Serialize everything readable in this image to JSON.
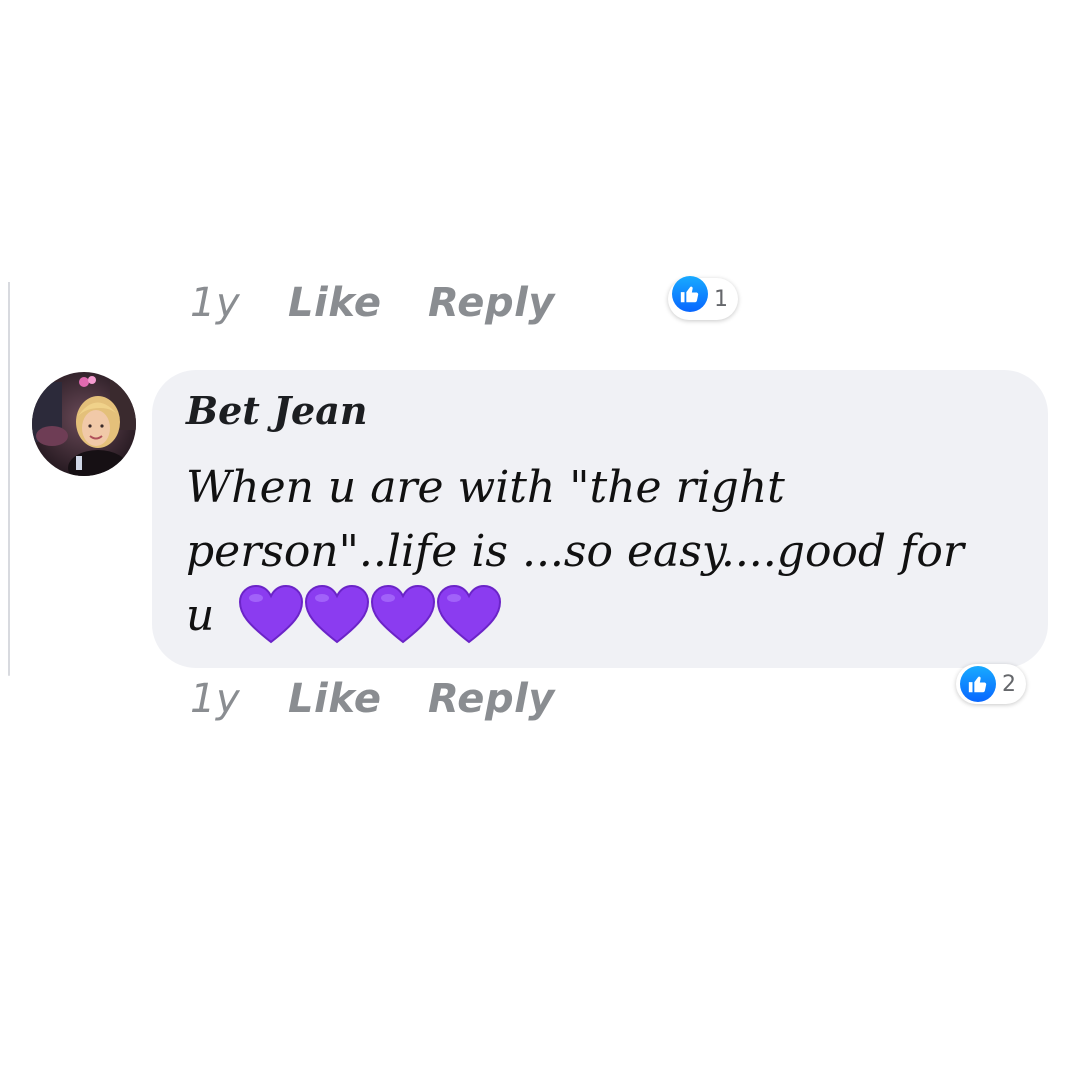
{
  "previous_comment": {
    "time": "1y",
    "like_label": "Like",
    "reply_label": "Reply",
    "reaction_count": "1"
  },
  "comment": {
    "author": "Bet Jean",
    "text": "When u are with \"the right person\"..life is ...so easy....good for u",
    "emoji": [
      "purple-heart",
      "purple-heart",
      "purple-heart",
      "purple-heart"
    ],
    "time": "1y",
    "like_label": "Like",
    "reply_label": "Reply",
    "reaction_count": "2"
  },
  "colors": {
    "bubble": "#f0f1f5",
    "action_text": "#8a8d91",
    "like_blue": "#0866ff",
    "heart_purple": "#8b3cf0"
  }
}
